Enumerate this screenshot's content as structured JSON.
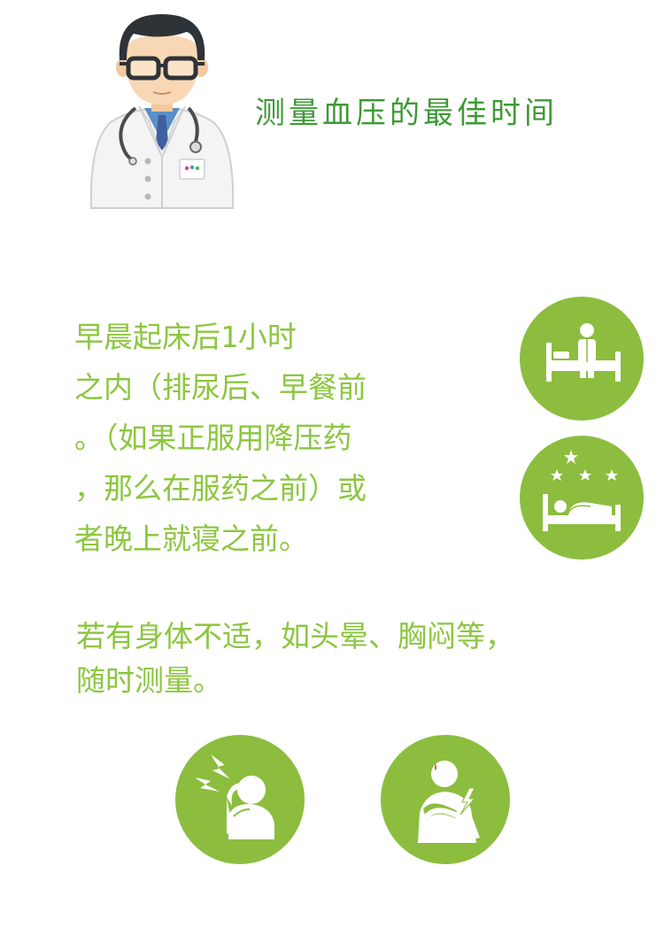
{
  "title": "测量血压的最佳时间",
  "tips": {
    "lines": [
      "     早晨起床后1小时",
      "之内（排尿后、早餐前",
      "。（如果正服用降压药",
      "，那么在服药之前）或",
      "者晚上就寝之前。"
    ]
  },
  "symptoms": {
    "lines": [
      "若有身体不适，如头晕、胸闷等，",
      "随时测量。"
    ]
  },
  "icons": {
    "doctor": "doctor-illustration",
    "wake": "sitting-on-bed-icon",
    "night": "sleeping-in-bed-with-stars-icon",
    "headache": "headache-icon",
    "chest": "chest-pain-icon"
  },
  "colors": {
    "title": "#3e9a35",
    "text": "#8cc63f",
    "circle": "#8cbd3f"
  }
}
